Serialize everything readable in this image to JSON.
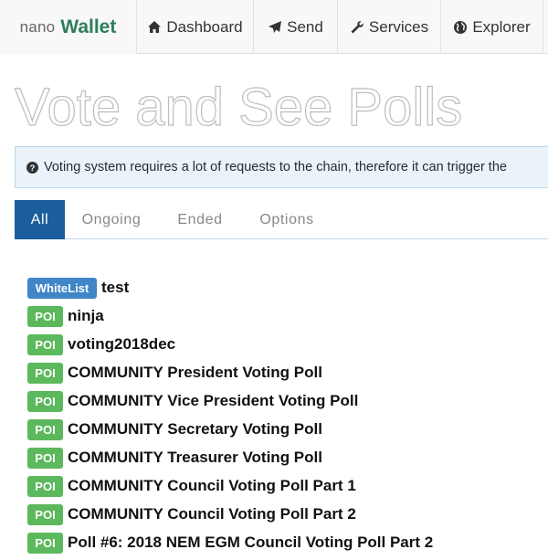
{
  "navbar": {
    "brand_prefix": "nano",
    "brand_main": "Wallet",
    "items": [
      {
        "label": "Dashboard",
        "icon": "home-icon"
      },
      {
        "label": "Send",
        "icon": "paper-plane-icon"
      },
      {
        "label": "Services",
        "icon": "wrench-icon"
      },
      {
        "label": "Explorer",
        "icon": "globe-icon"
      }
    ]
  },
  "page": {
    "title": "Vote and See Polls"
  },
  "alert": {
    "icon": "question-circle-icon",
    "text": "Voting system requires a lot of requests to the chain, therefore it can trigger the"
  },
  "tabs": [
    {
      "label": "All",
      "active": true
    },
    {
      "label": "Ongoing",
      "active": false
    },
    {
      "label": "Ended",
      "active": false
    },
    {
      "label": "Options",
      "active": false
    }
  ],
  "polls": [
    {
      "badge": "WhiteList",
      "name": "test"
    },
    {
      "badge": "POI",
      "name": "ninja"
    },
    {
      "badge": "POI",
      "name": "voting2018dec"
    },
    {
      "badge": "POI",
      "name": "COMMUNITY President Voting Poll"
    },
    {
      "badge": "POI",
      "name": "COMMUNITY Vice President Voting Poll"
    },
    {
      "badge": "POI",
      "name": "COMMUNITY Secretary Voting Poll"
    },
    {
      "badge": "POI",
      "name": "COMMUNITY Treasurer Voting Poll"
    },
    {
      "badge": "POI",
      "name": "COMMUNITY Council Voting Poll Part 1"
    },
    {
      "badge": "POI",
      "name": "COMMUNITY Council Voting Poll Part 2"
    },
    {
      "badge": "POI",
      "name": "Poll #6: 2018 NEM EGM Council Voting Poll Part 2"
    }
  ],
  "colors": {
    "brand_green": "#2e7d5b",
    "tab_active": "#1b5e9e",
    "badge_poi": "#5cb85c",
    "badge_whitelist": "#3f86c7",
    "alert_bg": "#eaf3fa"
  }
}
